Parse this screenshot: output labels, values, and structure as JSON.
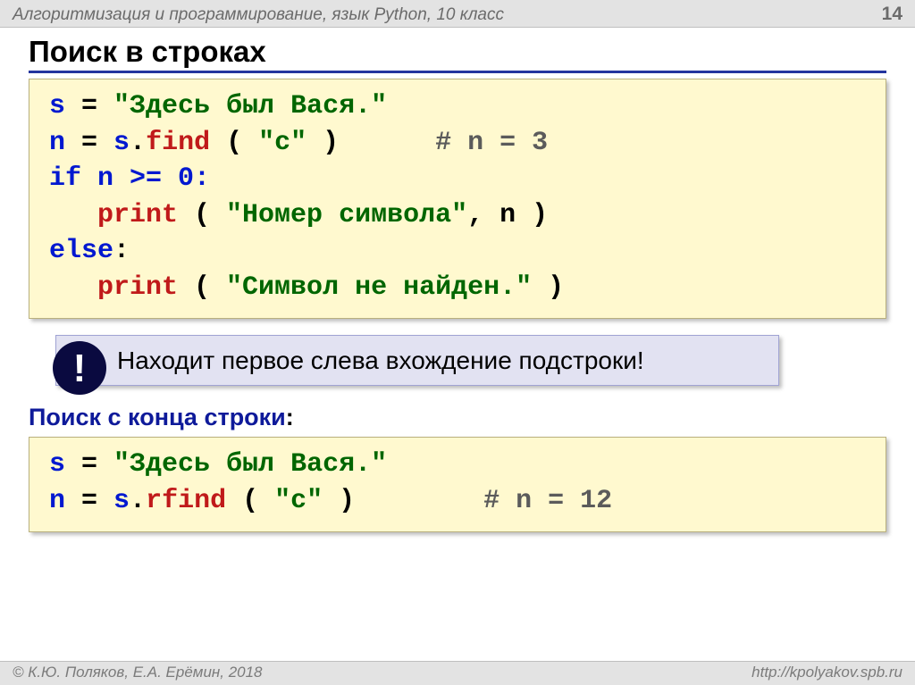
{
  "header": {
    "left": "Алгоритмизация и программирование, язык Python, 10 класс",
    "page_number": "14"
  },
  "title": "Поиск в строках",
  "code1": {
    "l1_var": "s",
    "l1_eq": " = ",
    "l1_str": "\"Здесь был Вася.\"",
    "l2_var": "n",
    "l2_eq": " = ",
    "l2_obj": "s",
    "l2_dot": ".",
    "l2_fn": "find",
    "l2_call": " ( ",
    "l2_arg": "\"с\"",
    "l2_close": " )      ",
    "l2_cmt": "# n = 3",
    "l3_kw": "if",
    "l3_rest": " n >= 0:",
    "l4_indent": "   ",
    "l4_fn": "print",
    "l4_call": " ( ",
    "l4_str": "\"Номер символа\"",
    "l4_rest": ", n )",
    "l5_kw": "else",
    "l5_colon": ":",
    "l6_indent": "   ",
    "l6_fn": "print",
    "l6_call": " ( ",
    "l6_str": "\"Символ не найден.\"",
    "l6_rest": " )"
  },
  "callout": {
    "badge": "!",
    "text": "Находит первое слева вхождение подстроки!"
  },
  "subheading": "Поиск с конца строки",
  "subheading_colon": ":",
  "code2": {
    "l1_var": "s",
    "l1_eq": " = ",
    "l1_str": "\"Здесь был Вася.\"",
    "l2_var": "n",
    "l2_eq": " = ",
    "l2_obj": "s",
    "l2_dot": ".",
    "l2_fn": "rfind",
    "l2_call": " ( ",
    "l2_arg": "\"с\"",
    "l2_close": " )        ",
    "l2_cmt": "# n = 12"
  },
  "footer": {
    "left": "© К.Ю. Поляков, Е.А. Ерёмин, 2018",
    "right": "http://kpolyakov.spb.ru"
  }
}
